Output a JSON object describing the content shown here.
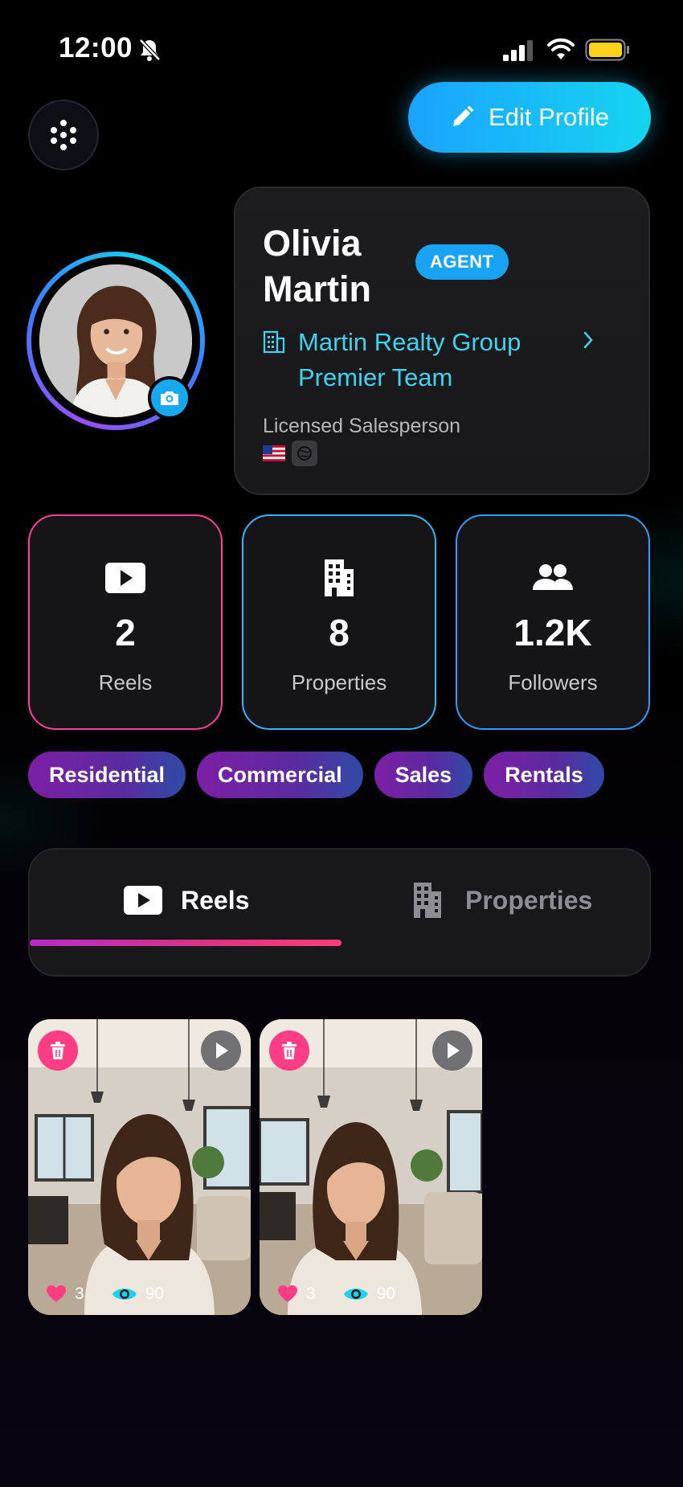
{
  "status_bar": {
    "time": "12:00"
  },
  "header": {
    "edit_label": "Edit Profile"
  },
  "profile": {
    "name": "Olivia Martin",
    "badge": "AGENT",
    "company": "Martin Realty Group Premier Team",
    "license": "Licensed Salesperson"
  },
  "stats": [
    {
      "value": "2",
      "label": "Reels",
      "icon": "play-icon"
    },
    {
      "value": "8",
      "label": "Properties",
      "icon": "building-icon"
    },
    {
      "value": "1.2K",
      "label": "Followers",
      "icon": "followers-icon"
    }
  ],
  "tags": [
    "Residential",
    "Commercial",
    "Sales",
    "Rentals"
  ],
  "tabs": [
    {
      "label": "Reels",
      "icon": "play-icon",
      "active": true
    },
    {
      "label": "Properties",
      "icon": "building-icon",
      "active": false
    }
  ],
  "reels": [
    {
      "likes": "3",
      "views": "90"
    },
    {
      "likes": "3",
      "views": "90"
    }
  ],
  "colors": {
    "accent_cyan": "#16d4f0",
    "accent_blue": "#1aa3ff",
    "accent_pink": "#ff3d9a",
    "tag_purple": "#7d1fa6",
    "company_text": "#3fd2ee"
  }
}
